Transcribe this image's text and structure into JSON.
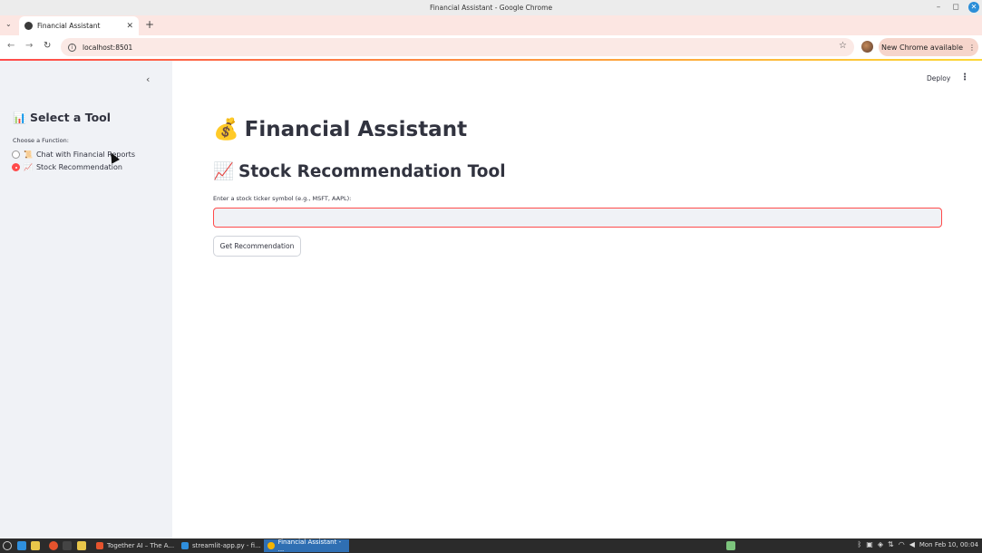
{
  "window": {
    "title": "Financial Assistant - Google Chrome",
    "minimize": "–",
    "maximize": "◻",
    "close": "✕"
  },
  "browser": {
    "tab_menu": "⌄",
    "tab_label": "Financial Assistant",
    "tab_close": "✕",
    "new_tab": "+",
    "back": "←",
    "forward": "→",
    "reload": "↻",
    "url": "localhost:8501",
    "bookmark": "☆",
    "update_label": "New Chrome available",
    "update_menu": "⋮"
  },
  "sidebar": {
    "collapse": "‹",
    "heading_icon": "📊",
    "heading": "Select a Tool",
    "radio_label": "Choose a Function:",
    "options": [
      {
        "icon": "📜",
        "label": "Chat with Financial Reports",
        "selected": false
      },
      {
        "icon": "📈",
        "label": "Stock Recommendation",
        "selected": true
      }
    ]
  },
  "main": {
    "deploy": "Deploy",
    "menu": "⋮",
    "title_icon": "💰",
    "title": "Financial Assistant",
    "subtitle_icon": "📈",
    "subtitle": "Stock Recommendation Tool",
    "input_label": "Enter a stock ticker symbol (e.g., MSFT, AAPL):",
    "input_value": "",
    "button_label": "Get Recommendation"
  },
  "taskbar": {
    "tasks": [
      {
        "label": "Together AI – The A...",
        "active": false
      },
      {
        "label": "streamlit-app.py - fi...",
        "active": false
      },
      {
        "label": "Financial Assistant - ...",
        "active": true
      }
    ],
    "clock": "Mon Feb 10, 00:04"
  },
  "colors": {
    "accent": "#ff4b4b",
    "sidebar_bg": "#f0f2f6",
    "text": "#31333f",
    "taskbar_bg": "#2b2b2b",
    "active_task": "#2f6fb3"
  }
}
